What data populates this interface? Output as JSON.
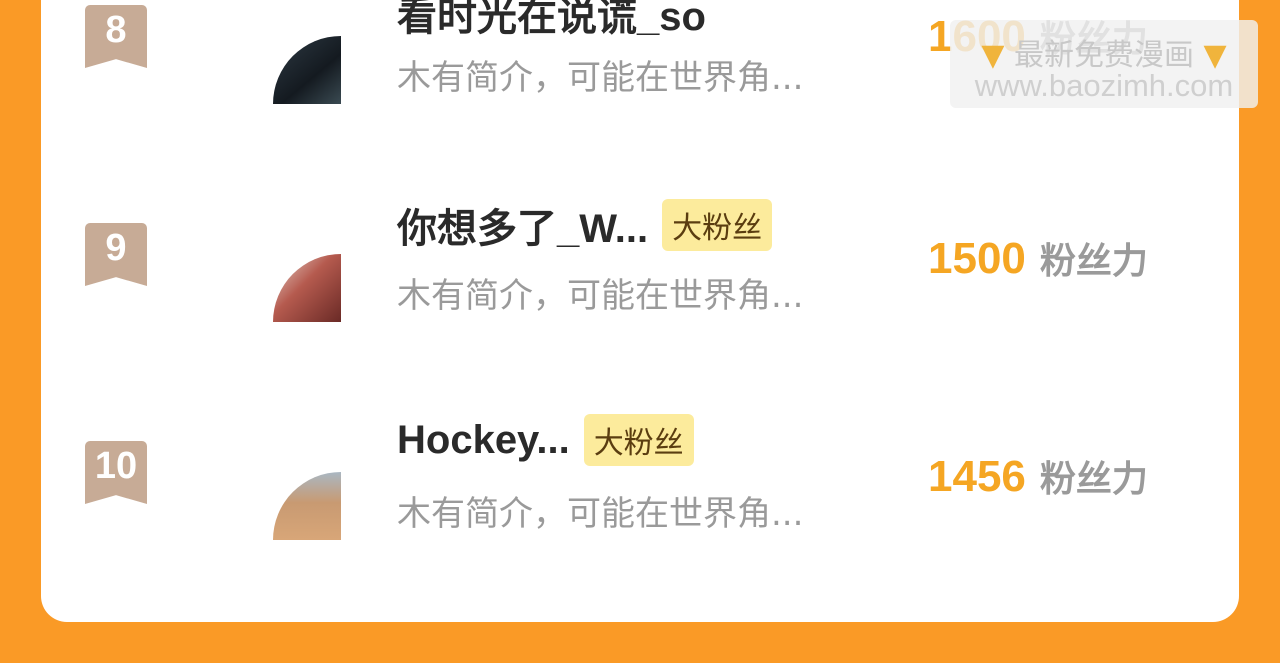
{
  "list": [
    {
      "rank": "8",
      "name": "看时光在说谎_so",
      "tag": "",
      "bio": "木有简介，可能在世界角...",
      "score": "1600",
      "unit": "粉丝力"
    },
    {
      "rank": "9",
      "name": "你想多了_W...",
      "tag": "大粉丝",
      "bio": "木有简介，可能在世界角...",
      "score": "1500",
      "unit": "粉丝力"
    },
    {
      "rank": "10",
      "name": "Hockey...",
      "tag": "大粉丝",
      "bio": "木有简介，可能在世界角...",
      "score": "1456",
      "unit": "粉丝力"
    }
  ],
  "watermark": {
    "line1": "最新免费漫画",
    "line2": "www.baozimh.com",
    "icon": "pointing-down-hand-icon"
  },
  "colors": {
    "background": "#FA9A26",
    "card": "#FFFFFF",
    "score": "#F5A623",
    "tag_bg": "#FCEB9C",
    "rank_badge": "#C7AB96"
  }
}
